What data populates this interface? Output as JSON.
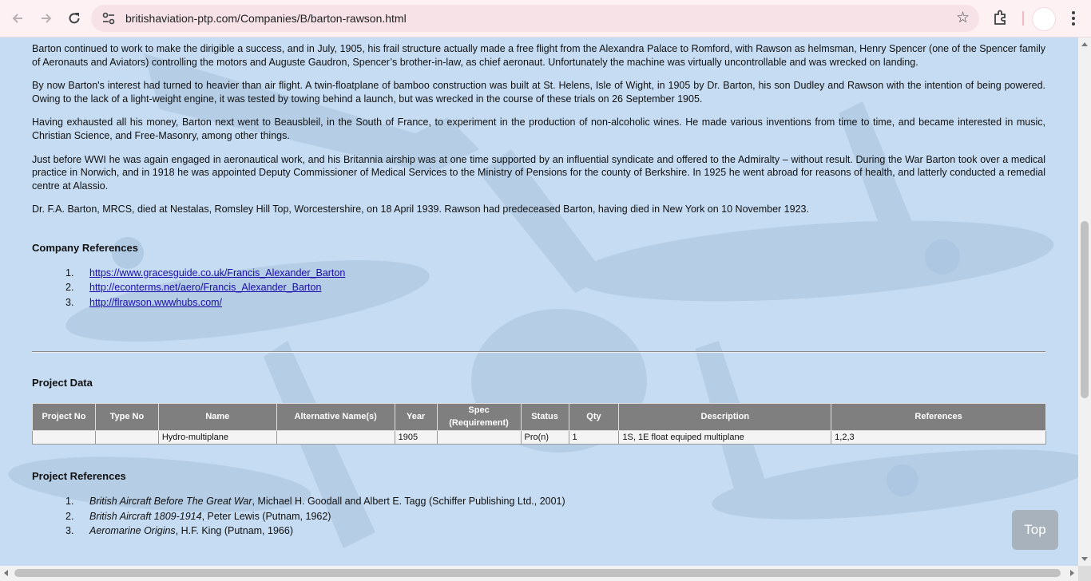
{
  "browser": {
    "url": "britishaviation-ptp.com/Companies/B/barton-rawson.html"
  },
  "article": {
    "paragraphs": [
      "Barton continued to work to make the dirigible a success, and in July, 1905, his frail structure actually made a free flight from the Alexandra Palace to Romford, with Rawson as helmsman, Henry Spencer (one of the Spencer family of Aeronauts and Aviators) controlling the motors and Auguste Gaudron, Spencer’s brother-in-law, as chief aeronaut. Unfortunately the machine was virtually uncontrollable and was wrecked on landing.",
      "By now Barton's interest had turned to heavier than air flight. A twin-floatplane of bamboo construction was built at St. Helens, Isle of Wight, in 1905 by Dr. Barton, his son Dudley and Rawson with the intention of being powered. Owing to the lack of a light-weight engine, it was tested by towing behind a launch, but was wrecked in the course of these trials on 26 September 1905.",
      "Having exhausted all his money, Barton next went to Beausbleil, in the South of France, to experiment in the production of non-alcoholic wines. He made various inventions from time to time, and became interested in music, Christian Science, and Free-Masonry, among other things.",
      "Just before WWI he was again engaged in aeronautical work, and his Britannia airship was at one time supported by an influential syndicate and offered to the Admiralty – without result. During the War Barton took over a medical practice in Norwich, and in 1918 he was appointed Deputy Commissioner of Medical Services to the Ministry of Pensions for the county of Berkshire. In 1925 he went abroad for reasons of health, and latterly conducted a remedial centre at Alassio.",
      "Dr. F.A. Barton, MRCS, died at Nestalas, Romsley Hill Top, Worcestershire, on 18 April 1939. Rawson had predeceased Barton, having died in New York on 10 November 1923."
    ]
  },
  "company_references": {
    "heading": "Company References",
    "items": [
      {
        "num": "1.",
        "text": "https://www.gracesguide.co.uk/Francis_Alexander_Barton"
      },
      {
        "num": "2.",
        "text": "http://econterms.net/aero/Francis_Alexander_Barton"
      },
      {
        "num": "3.",
        "text": "http://flrawson.wwwhubs.com/"
      }
    ]
  },
  "project_data": {
    "heading": "Project Data",
    "columns": [
      "Project No",
      "Type No",
      "Name",
      "Alternative Name(s)",
      "Year",
      "Spec (Requirement)",
      "Status",
      "Qty",
      "Description",
      "References"
    ],
    "rows": [
      [
        "",
        "",
        "Hydro-multiplane",
        "",
        "1905",
        "",
        "Pro(n)",
        "1",
        "1S, 1E float equiped multiplane",
        "1,2,3"
      ]
    ]
  },
  "project_references": {
    "heading": "Project References",
    "items": [
      {
        "num": "1.",
        "title": "British Aircraft Before The Great War",
        "rest": ", Michael H. Goodall and Albert E. Tagg (Schiffer Publishing Ltd., 2001)"
      },
      {
        "num": "2.",
        "title": "British Aircraft 1809-1914",
        "rest": ", Peter Lewis (Putnam, 1962)"
      },
      {
        "num": "3.",
        "title": "Aeromarine Origins",
        "rest": ", H.F. King (Putnam, 1966)"
      }
    ]
  },
  "top_button": {
    "label": "Top"
  }
}
